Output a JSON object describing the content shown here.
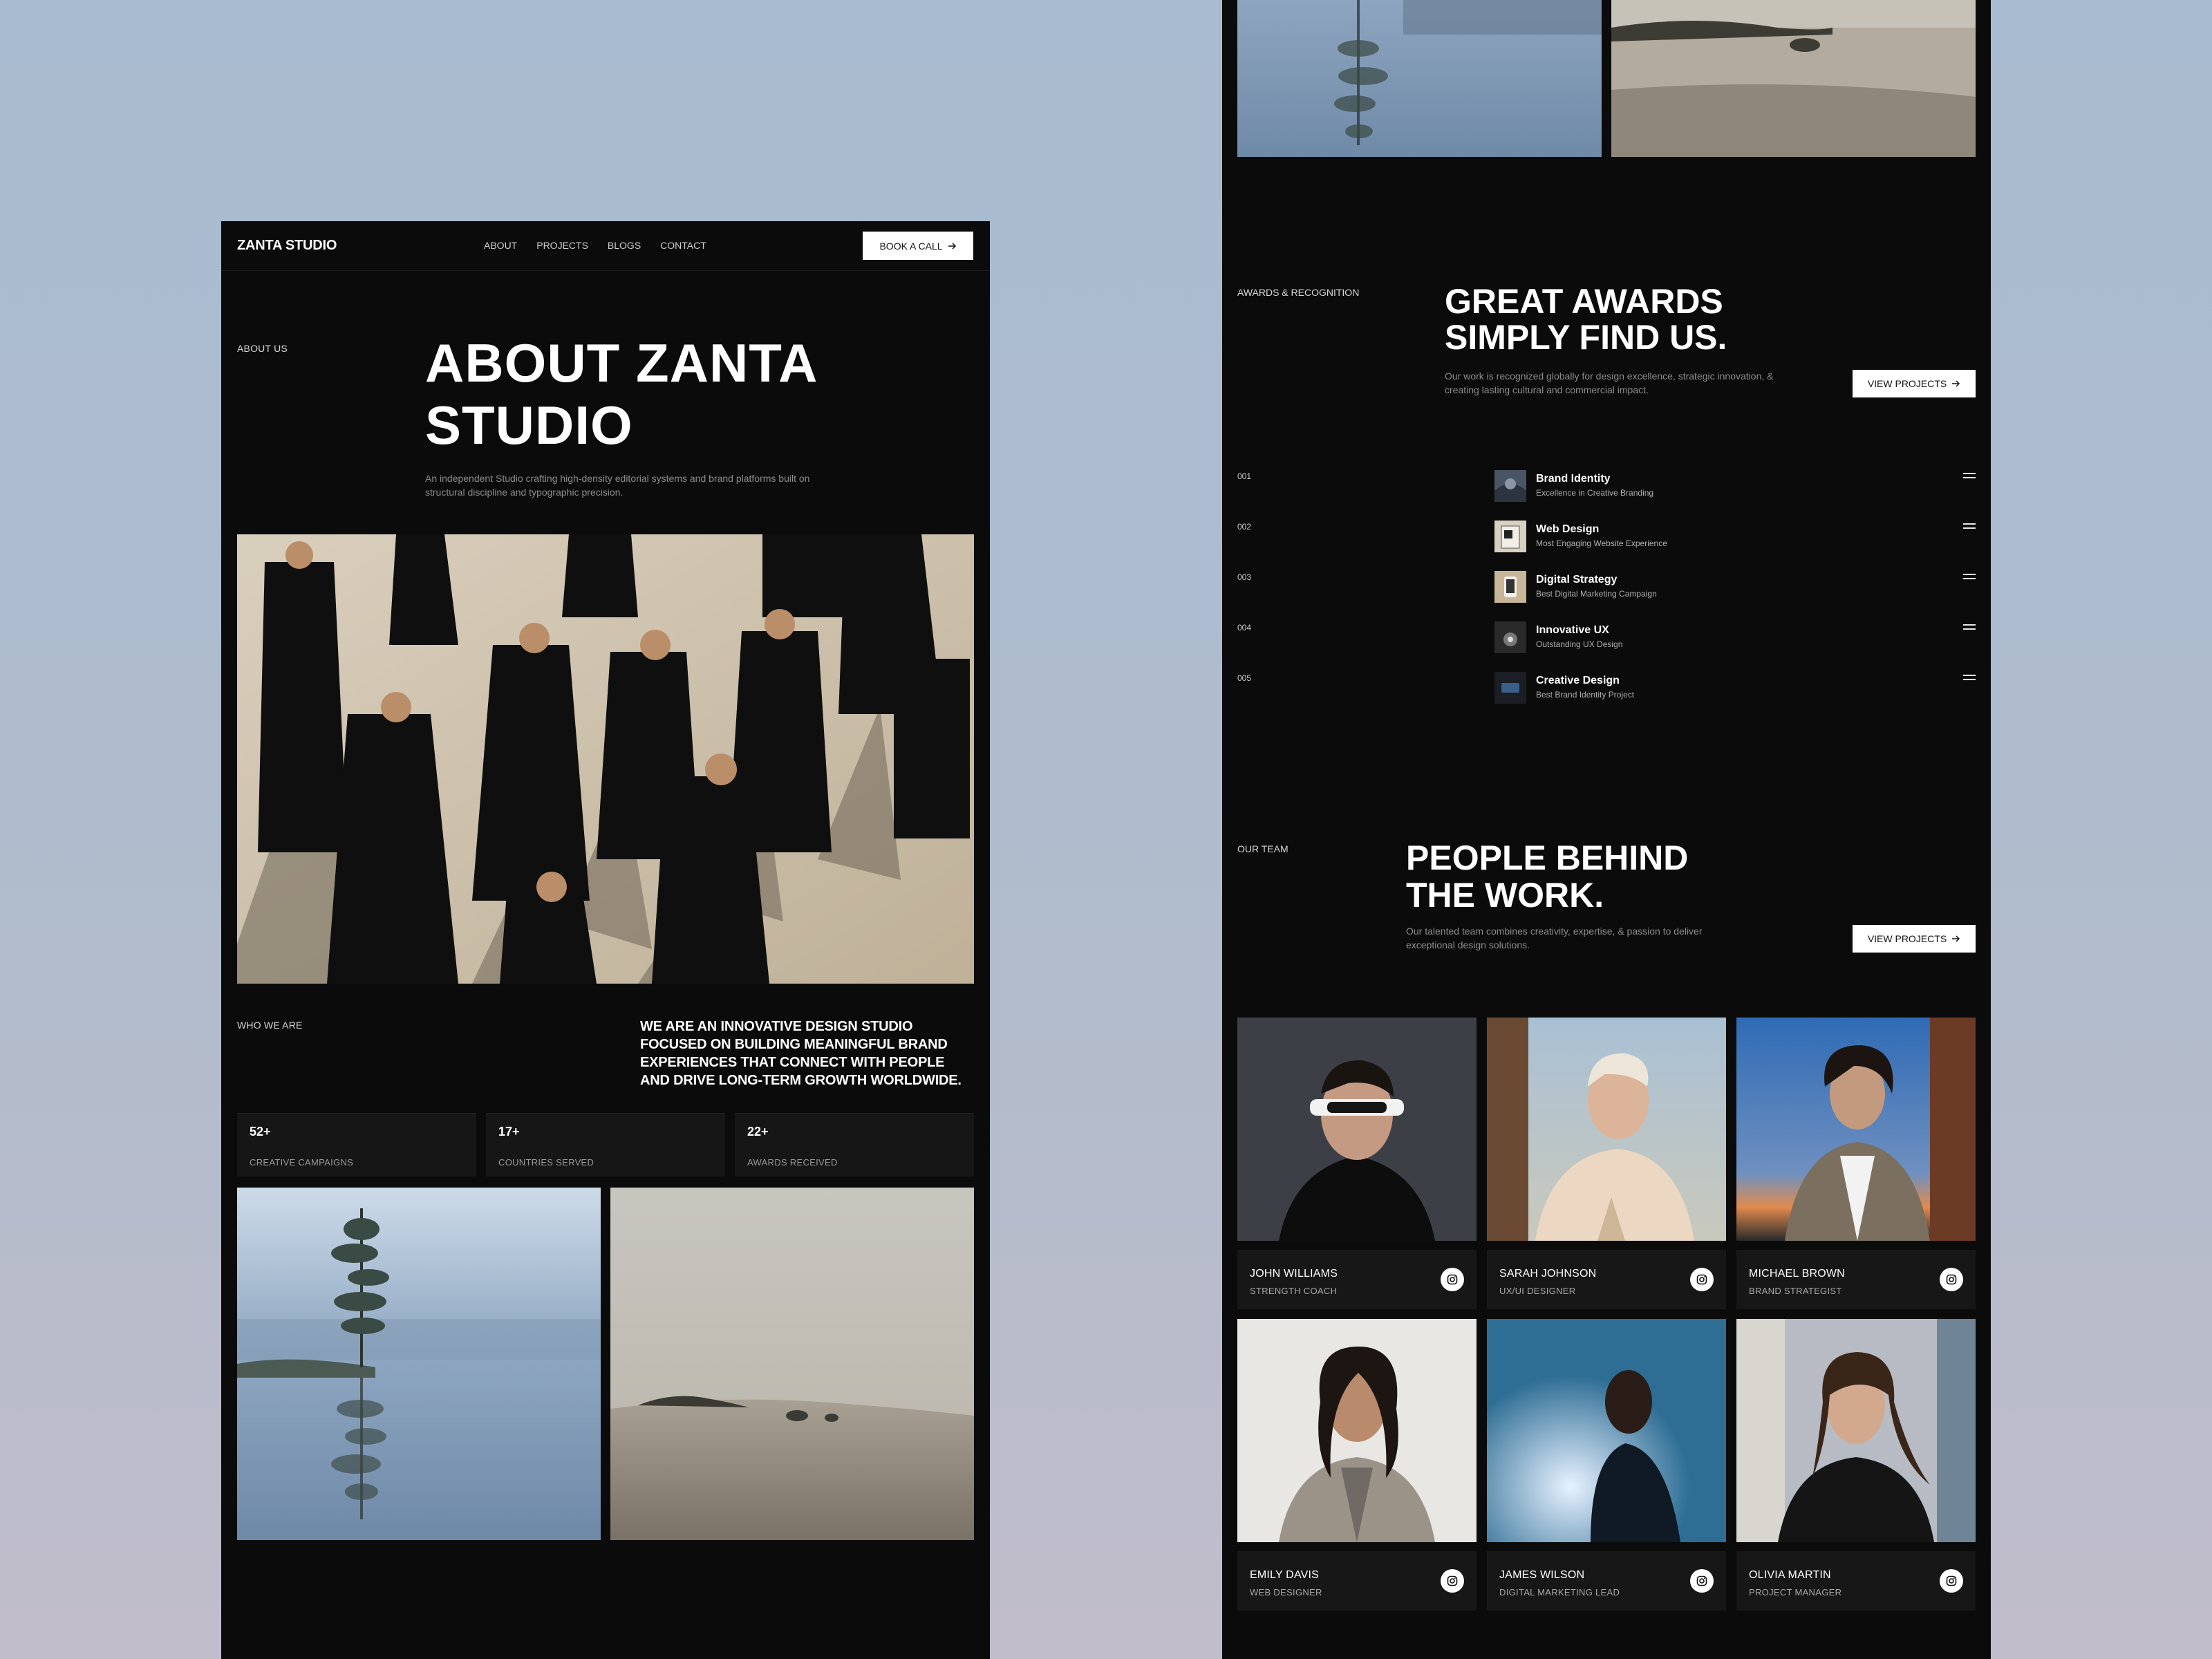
{
  "left": {
    "nav": {
      "logo": "ZANTA STUDIO",
      "links": [
        "ABOUT",
        "PROJECTS",
        "BLOGS",
        "CONTACT"
      ],
      "cta": "BOOK A CALL"
    },
    "about": {
      "eyebrow": "ABOUT US",
      "title_line1": "ABOUT ZANTA",
      "title_line2": "STUDIO",
      "subtitle": "An independent Studio crafting high-density editorial systems and brand platforms built on structural discipline and typographic precision."
    },
    "who": {
      "eyebrow": "WHO WE ARE",
      "text": "WE ARE AN INNOVATIVE DESIGN STUDIO FOCUSED ON BUILDING MEANINGFUL BRAND EXPERIENCES THAT CONNECT WITH PEOPLE AND DRIVE LONG-TERM GROWTH WORLDWIDE."
    },
    "stats": [
      {
        "value": "52+",
        "label": "CREATIVE CAMPAIGNS"
      },
      {
        "value": "17+",
        "label": "COUNTRIES SERVED"
      },
      {
        "value": "22+",
        "label": "AWARDS RECEIVED"
      }
    ]
  },
  "right": {
    "awards": {
      "eyebrow": "AWARDS & RECOGNITION",
      "title_line1": "GREAT AWARDS",
      "title_line2": "SIMPLY FIND US.",
      "subtitle": "Our work is recognized globally for design excellence, strategic innovation, & creating lasting cultural and commercial impact.",
      "button": "VIEW PROJECTS",
      "items": [
        {
          "num": "001",
          "title": "Brand Identity",
          "desc": "Excellence in Creative Branding"
        },
        {
          "num": "002",
          "title": "Web Design",
          "desc": "Most Engaging Website Experience"
        },
        {
          "num": "003",
          "title": "Digital Strategy",
          "desc": "Best Digital Marketing Campaign"
        },
        {
          "num": "004",
          "title": "Innovative UX",
          "desc": "Outstanding UX Design"
        },
        {
          "num": "005",
          "title": "Creative Design",
          "desc": "Best Brand Identity Project"
        }
      ]
    },
    "team": {
      "eyebrow": "OUR TEAM",
      "title_line1": "PEOPLE BEHIND",
      "title_line2": "THE WORK.",
      "subtitle": "Our talented team combines creativity, expertise, & passion to deliver exceptional design solutions.",
      "button": "VIEW PROJECTS",
      "members": [
        {
          "name": "JOHN WILLIAMS",
          "role": "STRENGTH COACH"
        },
        {
          "name": "SARAH JOHNSON",
          "role": "UX/UI DESIGNER"
        },
        {
          "name": "MICHAEL BROWN",
          "role": "BRAND STRATEGIST"
        },
        {
          "name": "EMILY DAVIS",
          "role": "WEB DESIGNER"
        },
        {
          "name": "JAMES WILSON",
          "role": "DIGITAL MARKETING LEAD"
        },
        {
          "name": "OLIVIA MARTIN",
          "role": "PROJECT MANAGER"
        }
      ]
    }
  },
  "colors": {
    "background_top": "#a9bbd0",
    "panel": "#0b0b0b",
    "card": "#171717",
    "button": "#ffffff"
  },
  "icons": [
    "arrow-right-icon",
    "menu-lines-icon",
    "instagram-icon"
  ]
}
